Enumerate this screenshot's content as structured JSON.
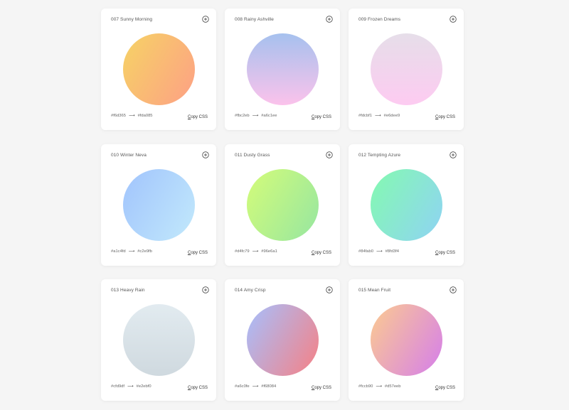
{
  "cards": [
    {
      "title": "007 Sunny Morning",
      "color_from": "#f6d365",
      "color_to": "#fda085",
      "gradient": "linear-gradient(120deg, #f6d365 0%, #fda085 100%)",
      "copy_label": "Copy CSS",
      "add_icon": "plus-circle-icon"
    },
    {
      "title": "008 Rainy Ashville",
      "color_from": "#fbc2eb",
      "color_to": "#a6c1ee",
      "gradient": "linear-gradient(to top, #fbc2eb 0%, #a6c1ee 100%)",
      "copy_label": "Copy CSS",
      "add_icon": "plus-circle-icon"
    },
    {
      "title": "009 Frozen Dreams",
      "color_from": "#fdcbf1",
      "color_to": "#e6dee9",
      "gradient": "linear-gradient(to top, #fdcbf1 0%, #e6dee9 100%)",
      "copy_label": "Copy CSS",
      "add_icon": "plus-circle-icon"
    },
    {
      "title": "010 Winter Neva",
      "color_from": "#a1c4fd",
      "color_to": "#c2e9fb",
      "gradient": "linear-gradient(120deg, #a1c4fd 0%, #c2e9fb 100%)",
      "copy_label": "Copy CSS",
      "add_icon": "plus-circle-icon"
    },
    {
      "title": "011 Dusty Grass",
      "color_from": "#d4fc79",
      "color_to": "#96e6a1",
      "gradient": "linear-gradient(120deg, #d4fc79 0%, #96e6a1 100%)",
      "copy_label": "Copy CSS",
      "add_icon": "plus-circle-icon"
    },
    {
      "title": "012 Tempting Azure",
      "color_from": "#84fab0",
      "color_to": "#8fd3f4",
      "gradient": "linear-gradient(120deg, #84fab0 0%, #8fd3f4 100%)",
      "copy_label": "Copy CSS",
      "add_icon": "plus-circle-icon"
    },
    {
      "title": "013 Heavy Rain",
      "color_from": "#cfd9df",
      "color_to": "#e2ebf0",
      "gradient": "linear-gradient(to top, #cfd9df 0%, #e2ebf0 100%)",
      "copy_label": "Copy CSS",
      "add_icon": "plus-circle-icon"
    },
    {
      "title": "014 Amy Crisp",
      "color_from": "#a6c0fe",
      "color_to": "#f68084",
      "gradient": "linear-gradient(120deg, #a6c0fe 0%, #f68084 100%)",
      "copy_label": "Copy CSS",
      "add_icon": "plus-circle-icon"
    },
    {
      "title": "015 Mean Fruit",
      "color_from": "#fccb90",
      "color_to": "#d57eeb",
      "gradient": "linear-gradient(120deg, #fccb90 0%, #d57eeb 100%)",
      "copy_label": "Copy CSS",
      "add_icon": "plus-circle-icon"
    }
  ]
}
